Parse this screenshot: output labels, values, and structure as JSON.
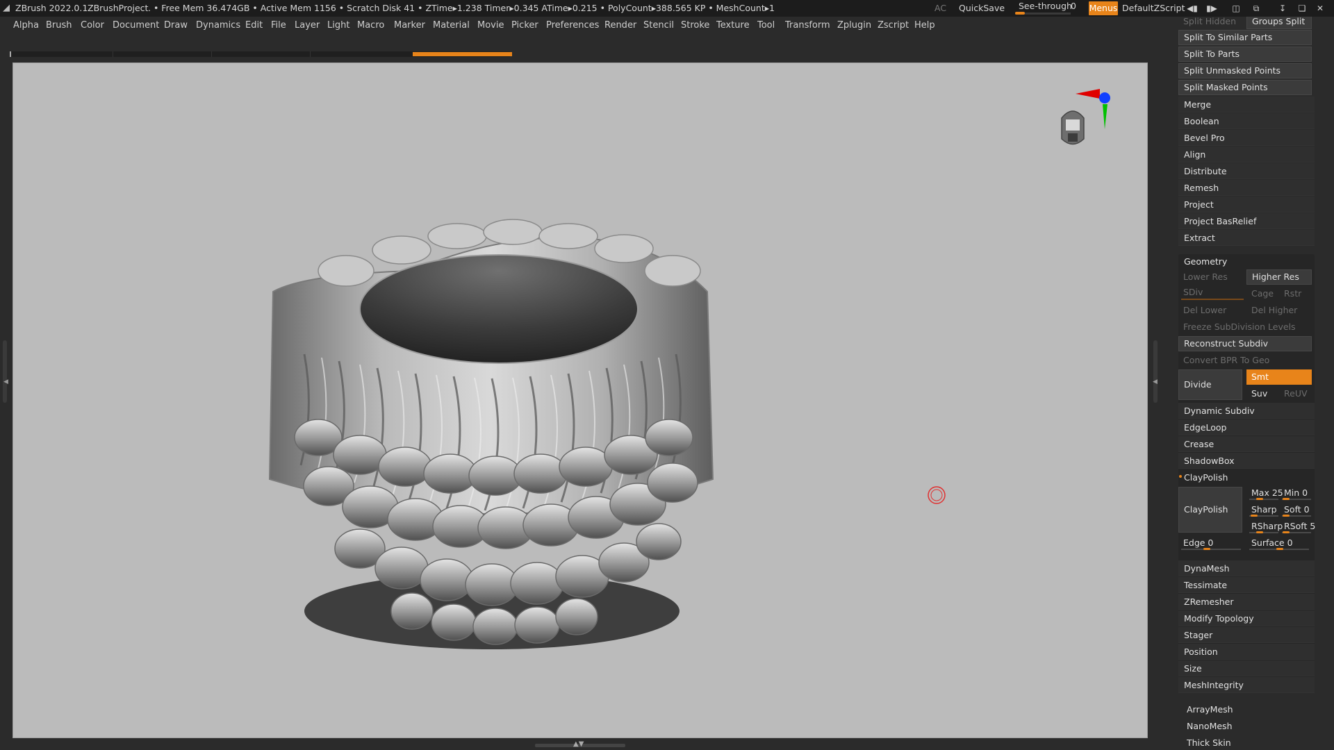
{
  "titlebar": {
    "app": "ZBrush 2022.0.1",
    "project": "ZBrushProject",
    "stats": ". • Free Mem 36.474GB • Active Mem 1156 • Scratch Disk 41 •  ZTime▸1.238 Timer▸0.345 ATime▸0.215 • PolyCount▸388.565 KP  • MeshCount▸1",
    "ac": "AC",
    "quicksave": "QuickSave",
    "seethrough": "See-through",
    "seethrough_value": "0",
    "seethrough_level": 0,
    "menus": "Menus",
    "script": "DefaultZScript"
  },
  "menubar": [
    "Alpha",
    "Brush",
    "Color",
    "Document",
    "Draw",
    "Dynamics",
    "Edit",
    "File",
    "Layer",
    "Light",
    "Macro",
    "Marker",
    "Material",
    "Movie",
    "Picker",
    "Preferences",
    "Render",
    "Stencil",
    "Stroke",
    "Texture",
    "Tool",
    "Transform",
    "Zplugin",
    "Zscript",
    "Help"
  ],
  "panel": {
    "top_partial": {
      "split_hidden": "Split Hidden",
      "groups_split": "Groups Split"
    },
    "split_buttons": [
      "Split To Similar Parts",
      "Split To Parts",
      "Split Unmasked Points",
      "Split Masked Points"
    ],
    "subtool_rows": [
      "Merge",
      "Boolean",
      "Bevel Pro",
      "Align",
      "Distribute",
      "Remesh",
      "Project",
      "Project BasRelief",
      "Extract"
    ],
    "geometry": {
      "title": "Geometry",
      "lower_res": "Lower Res",
      "higher_res": "Higher Res",
      "sdiv": "SDiv",
      "cage": "Cage",
      "rstr": "Rstr",
      "del_lower": "Del Lower",
      "del_higher": "Del Higher",
      "freeze": "Freeze SubDivision Levels",
      "reconstruct": "Reconstruct Subdiv",
      "convert_bpr": "Convert BPR To Geo",
      "divide": "Divide",
      "smt": "Smt",
      "suv": "Suv",
      "reuv": "ReUV",
      "rows": [
        "Dynamic Subdiv",
        "EdgeLoop",
        "Crease",
        "ShadowBox"
      ],
      "claypolish": {
        "header": "ClayPolish",
        "button": "ClayPolish",
        "max": "Max 25",
        "min": "Min 0",
        "sharp": "Sharp",
        "soft": "Soft 0",
        "rsharp": "RSharp",
        "rsoft": "RSoft 5",
        "edge": "Edge 0",
        "surface": "Surface 0"
      },
      "rows2": [
        "DynaMesh",
        "Tessimate",
        "ZRemesher",
        "Modify Topology",
        "Stager",
        "Position",
        "Size",
        "MeshIntegrity"
      ]
    },
    "extra_rows": [
      "ArrayMesh",
      "NanoMesh",
      "Thick Skin"
    ]
  }
}
